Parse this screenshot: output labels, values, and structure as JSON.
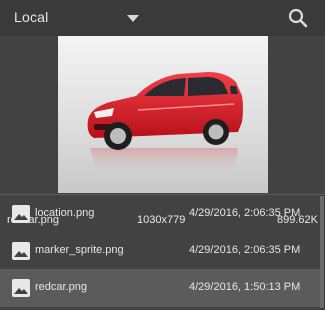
{
  "header": {
    "location_label": "Local",
    "dropdown_icon": "chevron-down-icon",
    "search_icon": "search-icon"
  },
  "preview": {
    "filename": "redcar.png",
    "dimensions": "1030x779",
    "filesize": "899.62K"
  },
  "files": [
    {
      "name": "location.png",
      "date": "4/29/2016, 2:06:35 PM",
      "icon": "image-icon",
      "selected": false
    },
    {
      "name": "marker_sprite.png",
      "date": "4/29/2016, 2:06:35 PM",
      "icon": "image-icon",
      "selected": false
    },
    {
      "name": "redcar.png",
      "date": "4/29/2016, 1:50:13 PM",
      "icon": "image-icon",
      "selected": true
    }
  ],
  "colors": {
    "background": "#424242",
    "header": "#3a3a3a",
    "selected_row": "#5b5b5b",
    "car_red": "#e0202a"
  }
}
